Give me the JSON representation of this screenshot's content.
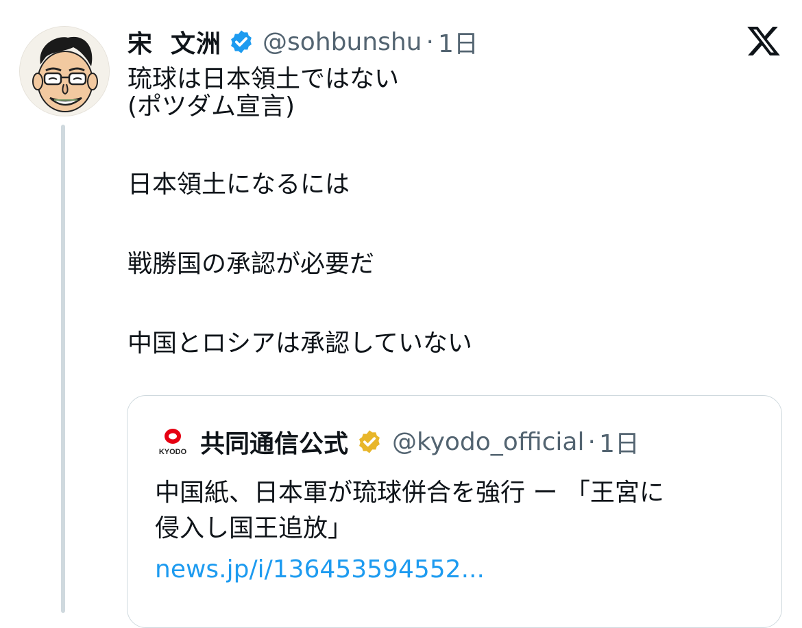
{
  "author": {
    "display_name_part1": "宋",
    "display_name_part2": "文洲",
    "handle": "@sohbunshu",
    "separator": "·",
    "time": "1日",
    "avatar_icon": "caricature-avatar-icon",
    "verified_color": "#1d9bf0"
  },
  "tweet": {
    "lines": [
      "琉球は日本領土ではない",
      "(ポツダム宣言)",
      "",
      "日本領土になるには",
      "",
      "戦勝国の承認が必要だ",
      "",
      "中国とロシアは承認していない"
    ]
  },
  "quote": {
    "display_name": "共同通信公式",
    "handle": "@kyodo_official",
    "separator": "·",
    "time": "1日",
    "logo_text": "KYODO",
    "verified_color": "#e8b62a",
    "text_line1": "中国紙、日本軍が琉球併合を強行 ー 「王宮に",
    "text_line2": "侵入し国王追放」",
    "link": "news.jp/i/136453594552..."
  },
  "brand": {
    "icon": "x-logo-icon"
  }
}
